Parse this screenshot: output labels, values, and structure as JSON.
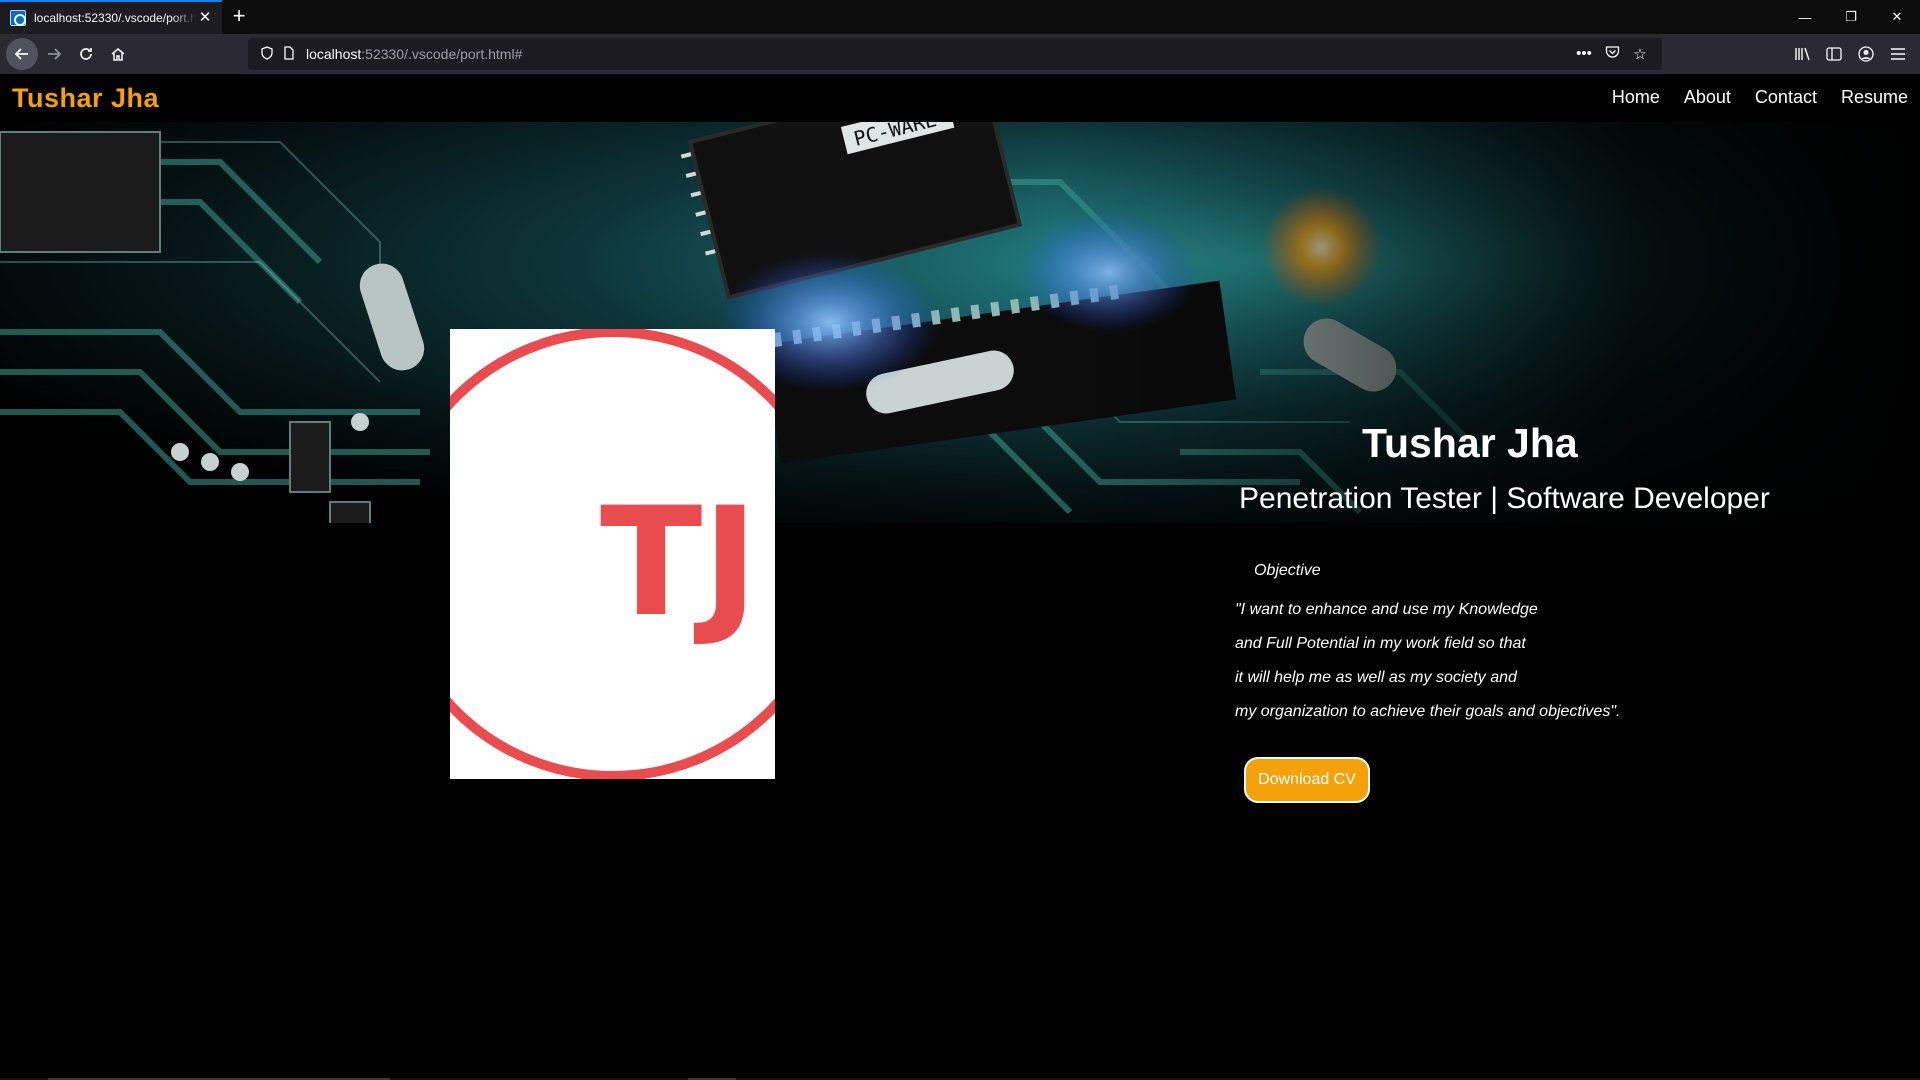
{
  "browser": {
    "tab_title": "localhost:52330/.vscode/port.html#",
    "url_host": "localhost",
    "url_rest": ":52330/.vscode/port.html#",
    "new_tab_symbol": "+",
    "icons": {
      "back": "back-arrow-icon",
      "forward": "forward-arrow-icon",
      "reload": "reload-icon",
      "home": "home-icon",
      "tracking": "shield-icon",
      "page": "page-icon",
      "more": "more-icon",
      "pocket": "pocket-icon",
      "bookmark": "star-icon",
      "library": "library-icon",
      "sidebar": "sidebar-icon",
      "account": "account-icon",
      "menu": "hamburger-icon"
    }
  },
  "site": {
    "brand": "Tushar Jha",
    "menu": [
      "Home",
      "About",
      "Contact",
      "Resume"
    ],
    "avatar_initials": "TJ",
    "intro": {
      "name": "Tushar Jha",
      "role": "Penetration Tester | Software Developer"
    },
    "objective": {
      "title": "Objective",
      "lines": [
        "\"I want to enhance and use my Knowledge",
        "and Full Potential in my work field so that",
        "it will help me as well as my society and",
        "my organization to achieve their goals and objectives\"."
      ]
    },
    "download_button": "Download CV",
    "colors": {
      "brand": "#f5a20a",
      "avatar_red": "#e84c4f",
      "button_bg": "#f5a20a"
    }
  }
}
